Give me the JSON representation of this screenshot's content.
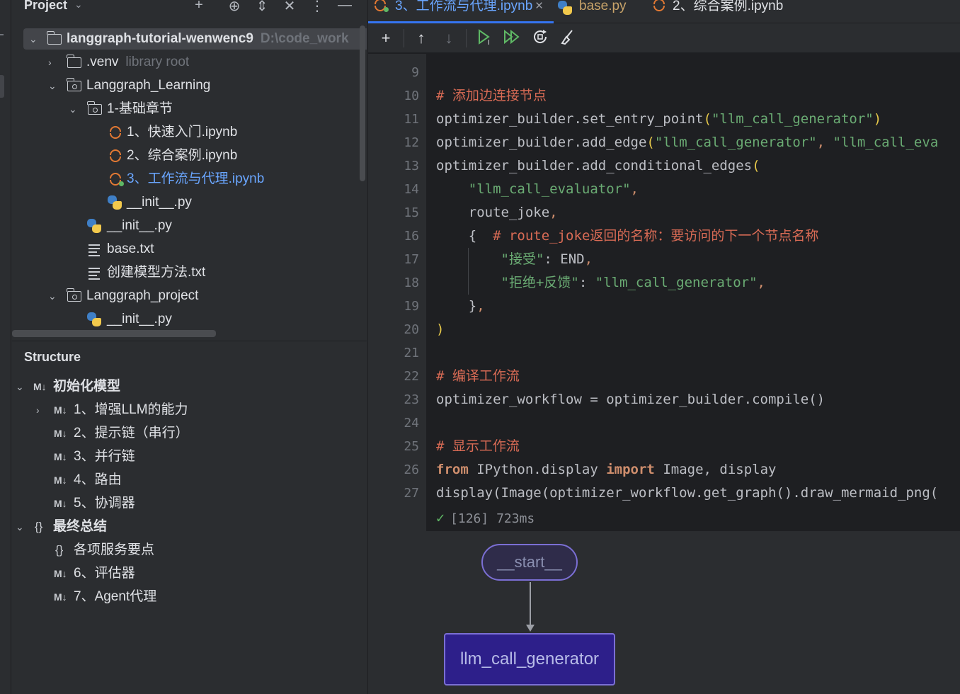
{
  "project_panel": {
    "title": "Project",
    "tree": [
      {
        "label": "langgraph-tutorial-wenwenc9",
        "sub": "D:\\code_work"
      },
      {
        "label": ".venv",
        "sub": "library root"
      },
      {
        "label": "Langgraph_Learning"
      },
      {
        "label": "1-基础章节"
      },
      {
        "label": "1、快速入门.ipynb"
      },
      {
        "label": "2、综合案例.ipynb"
      },
      {
        "label": "3、工作流与代理.ipynb"
      },
      {
        "label": "__init__.py"
      },
      {
        "label": "__init__.py"
      },
      {
        "label": "base.txt"
      },
      {
        "label": "创建模型方法.txt"
      },
      {
        "label": "Langgraph_project"
      },
      {
        "label": "__init__.py"
      }
    ]
  },
  "structure_panel": {
    "title": "Structure",
    "items": [
      {
        "marker": "M↓",
        "label": "初始化模型"
      },
      {
        "marker": "M↓",
        "label": "1、增强LLM的能力"
      },
      {
        "marker": "M↓",
        "label": "2、提示链（串行）"
      },
      {
        "marker": "M↓",
        "label": "3、并行链"
      },
      {
        "marker": "M↓",
        "label": "4、路由"
      },
      {
        "marker": "M↓",
        "label": "5、协调器"
      },
      {
        "marker": "{}",
        "label": "最终总结"
      },
      {
        "marker": "{}",
        "label": "各项服务要点"
      },
      {
        "marker": "M↓",
        "label": "6、评估器"
      },
      {
        "marker": "M↓",
        "label": "7、Agent代理"
      }
    ]
  },
  "tabs": [
    {
      "label": "3、工作流与代理.ipynb",
      "active": true,
      "close": "×"
    },
    {
      "label": "base.py"
    },
    {
      "label": "2、综合案例.ipynb"
    }
  ],
  "toolbar": {
    "add": "+",
    "up": "↑",
    "down": "↓"
  },
  "code": {
    "lines": [
      {
        "n": "9"
      },
      {
        "n": "10",
        "comment": "# 添加边连接节点"
      },
      {
        "n": "11",
        "pre": "optimizer_builder.set_entry_point",
        "s1": "\"llm_call_generator\""
      },
      {
        "n": "12",
        "pre": "optimizer_builder.add_edge",
        "s1": "\"llm_call_generator\"",
        "s2": "\"llm_call_eva"
      },
      {
        "n": "13",
        "pre": "optimizer_builder.add_conditional_edges"
      },
      {
        "n": "14",
        "s1": "\"llm_call_evaluator\""
      },
      {
        "n": "15",
        "pre": "route_joke"
      },
      {
        "n": "16",
        "pre": "{",
        "comment": "# route_joke返回的名称：要访问的下一个节点名称"
      },
      {
        "n": "17",
        "s1": "\"接受\"",
        "pre": ": END"
      },
      {
        "n": "18",
        "s1": "\"拒绝+反馈\"",
        "s2": "\"llm_call_generator\""
      },
      {
        "n": "19",
        "pre": "}"
      },
      {
        "n": "20",
        "pre": ")"
      },
      {
        "n": "21"
      },
      {
        "n": "22",
        "comment": "# 编译工作流"
      },
      {
        "n": "23",
        "pre": "optimizer_workflow = optimizer_builder.compile()"
      },
      {
        "n": "24"
      },
      {
        "n": "25",
        "comment": "# 显示工作流"
      },
      {
        "n": "26",
        "kw1": "from",
        "mid": " IPython.display ",
        "kw2": "import",
        "post": " Image, display"
      },
      {
        "n": "27",
        "pre": "display(Image(optimizer_workflow.get_graph().draw_mermaid_png("
      }
    ],
    "status_check": "✓",
    "status_text": "[126] 723ms"
  },
  "graph": {
    "start_node": "__start__",
    "node1": "llm_call_generator"
  }
}
